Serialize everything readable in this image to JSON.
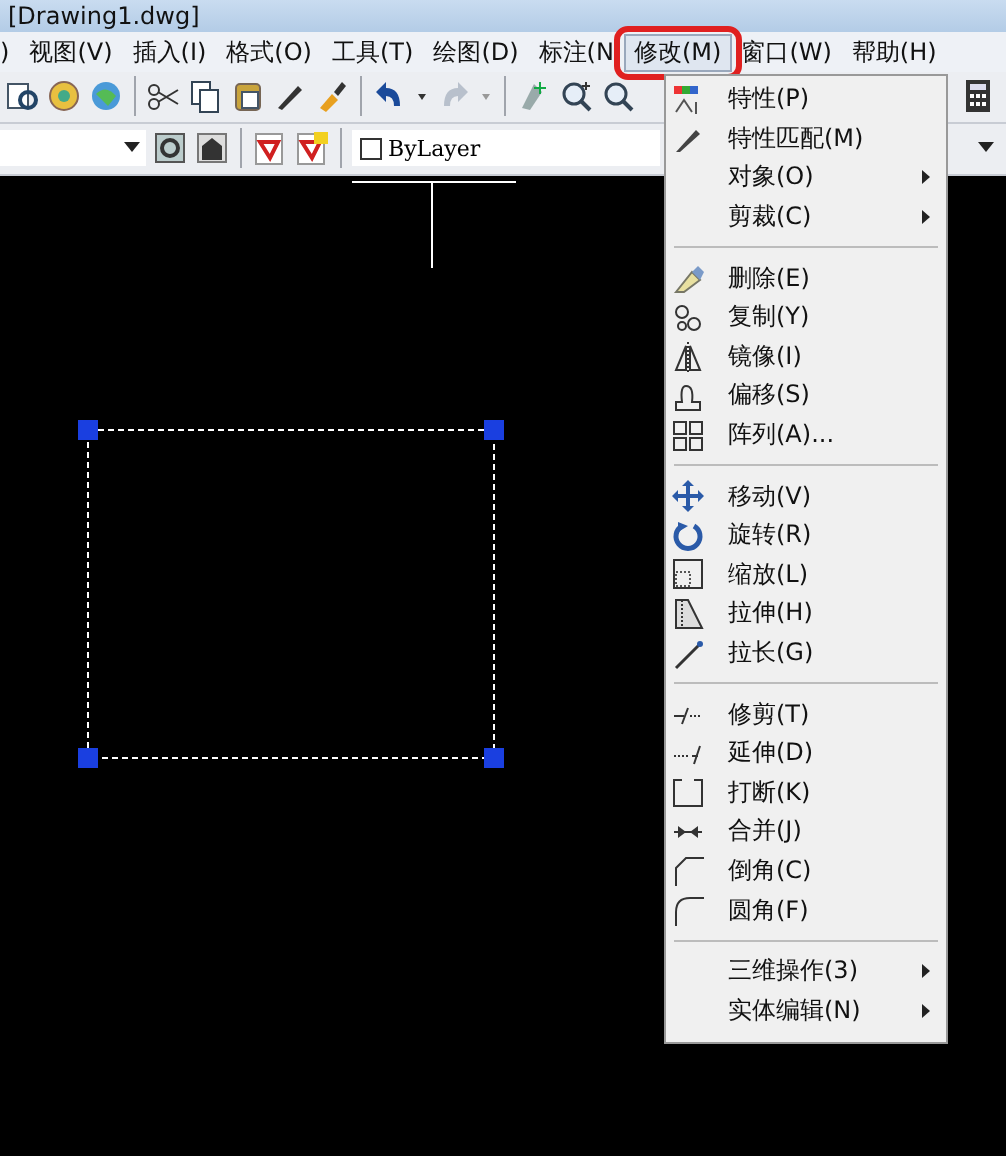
{
  "window": {
    "title": "[Drawing1.dwg]"
  },
  "menu_bar": [
    {
      "label": ")",
      "selected": false
    },
    {
      "label": "视图(V)",
      "selected": false
    },
    {
      "label": "插入(I)",
      "selected": false
    },
    {
      "label": "格式(O)",
      "selected": false
    },
    {
      "label": "工具(T)",
      "selected": false
    },
    {
      "label": "绘图(D)",
      "selected": false
    },
    {
      "label": "标注(N",
      "selected": false
    },
    {
      "label": "修改(M)",
      "selected": true
    },
    {
      "label": "窗口(W)",
      "selected": false
    },
    {
      "label": "帮助(H)",
      "selected": false
    }
  ],
  "annotation": {
    "kind": "ring"
  },
  "layer_box": {
    "value": "ByLayer"
  },
  "dropdown_menu": {
    "groups": [
      [
        {
          "label": "特性(P)",
          "submenu": false
        },
        {
          "label": "特性匹配(M)",
          "submenu": false
        },
        {
          "label": "对象(O)",
          "submenu": true
        },
        {
          "label": "剪裁(C)",
          "submenu": true
        }
      ],
      [
        {
          "label": "删除(E)",
          "submenu": false
        },
        {
          "label": "复制(Y)",
          "submenu": false
        },
        {
          "label": "镜像(I)",
          "submenu": false
        },
        {
          "label": "偏移(S)",
          "submenu": false
        },
        {
          "label": "阵列(A)...",
          "submenu": false
        }
      ],
      [
        {
          "label": "移动(V)",
          "submenu": false
        },
        {
          "label": "旋转(R)",
          "submenu": false
        },
        {
          "label": "缩放(L)",
          "submenu": false
        },
        {
          "label": "拉伸(H)",
          "submenu": false
        },
        {
          "label": "拉长(G)",
          "submenu": false
        }
      ],
      [
        {
          "label": "修剪(T)",
          "submenu": false
        },
        {
          "label": "延伸(D)",
          "submenu": false
        },
        {
          "label": "打断(K)",
          "submenu": false
        },
        {
          "label": "合并(J)",
          "submenu": false
        },
        {
          "label": "倒角(C)",
          "submenu": false
        },
        {
          "label": "圆角(F)",
          "submenu": false
        }
      ],
      [
        {
          "label": "三维操作(3)",
          "submenu": true
        },
        {
          "label": "实体编辑(N)",
          "submenu": true
        }
      ]
    ]
  }
}
